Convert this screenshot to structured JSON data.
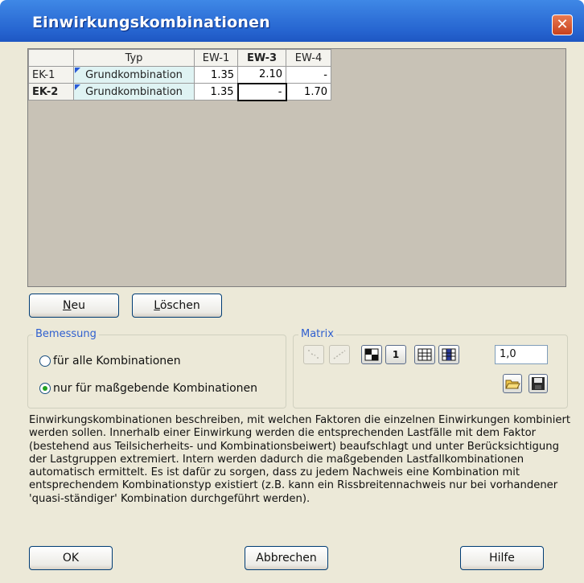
{
  "window": {
    "title": "Einwirkungskombinationen",
    "close_glyph": "✕"
  },
  "table": {
    "headers": [
      "",
      "Typ",
      "EW-1",
      "EW-3",
      "EW-4"
    ],
    "rows": [
      {
        "id": "EK-1",
        "typ": "Grundkombination",
        "values": [
          "1.35",
          "2.10",
          "-"
        ]
      },
      {
        "id": "EK-2",
        "typ": "Grundkombination",
        "values": [
          "1.35",
          "-",
          "1.70"
        ]
      }
    ]
  },
  "buttons": {
    "neu_u": "N",
    "neu_rest": "eu",
    "loeschen_u": "L",
    "loeschen_rest": "öschen",
    "ok": "OK",
    "abbrechen": "Abbrechen",
    "hilfe": "Hilfe"
  },
  "bemessung": {
    "legend": "Bemessung",
    "option_all": "für alle Kombinationen",
    "option_relevant": "nur für maßgebende Kombinationen",
    "selected": "option_relevant"
  },
  "matrix": {
    "legend": "Matrix",
    "one_label": "1",
    "value": "1,0",
    "icons": [
      "matrix-disabled-1-icon",
      "matrix-disabled-2-icon",
      "checker-grid-icon",
      "one-icon",
      "grid-icon",
      "grid-filled-icon",
      "open-folder-icon",
      "save-floppy-icon"
    ]
  },
  "description": "Einwirkungskombinationen beschreiben, mit welchen Faktoren die einzelnen Einwirkungen kombiniert werden sollen. Innerhalb einer Einwirkung werden die entsprechenden Lastfälle mit dem Faktor (bestehend aus Teilsicherheits- und Kombinationsbeiwert) beaufschlagt und unter Berücksichtigung der Lastgruppen extremiert. Intern werden dadurch die maßgebenden Lastfallkombinationen automatisch ermittelt. Es ist dafür zu sorgen, dass zu jedem Nachweis eine Kombination mit entsprechendem Kombinationstyp existiert (z.B. kann ein Rissbreitennachweis nur bei vorhandener 'quasi-ständiger' Kombination durchgeführt werden).",
  "colors": {
    "title_bar": "#2563cf",
    "dialog_bg": "#ece9d8",
    "grid_bg": "#c8c2b6",
    "typ_cell": "#dff3f3",
    "legend_text": "#2f5fcf"
  }
}
